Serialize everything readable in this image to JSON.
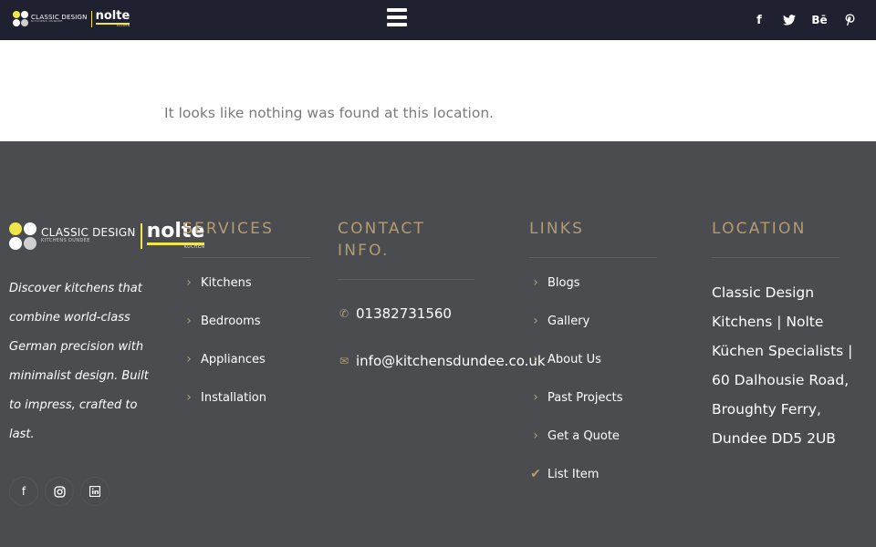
{
  "header": {
    "logo": {
      "brand_left": "CLASSIC DESIGN",
      "brand_left_sub": "KITCHENS DUNDEE",
      "brand_right": "nolte",
      "brand_right_sub": "KÜCHEN"
    },
    "menu_icon": "hamburger-menu-icon",
    "social": [
      {
        "icon": "facebook-icon",
        "glyph": "f"
      },
      {
        "icon": "twitter-icon",
        "glyph": "🐦"
      },
      {
        "icon": "behance-icon",
        "glyph": "Bē"
      },
      {
        "icon": "pinterest-icon",
        "glyph": "P"
      }
    ]
  },
  "main": {
    "message": "It looks like nothing was found at this location."
  },
  "footer": {
    "logo": {
      "brand_left": "CLASSIC DESIGN",
      "brand_left_sub": "KITCHENS DUNDEE",
      "brand_right": "nolte",
      "brand_right_sub": "KÜCHEN"
    },
    "tagline": "Discover kitchens that combine world-class German precision with minimalist design. Built to impress, crafted to last.",
    "social": [
      {
        "icon": "facebook-icon",
        "glyph": "f"
      },
      {
        "icon": "instagram-icon",
        "glyph": "◎"
      },
      {
        "icon": "linkedin-icon",
        "glyph": "in"
      }
    ],
    "services": {
      "title": "SERVICES",
      "items": [
        "Kitchens",
        "Bedrooms",
        "Appliances",
        "Installation"
      ]
    },
    "contact": {
      "title_line1": "CONTACT",
      "title_line2": "INFO.",
      "phone": "01382731560",
      "email": "info@kitchensdundee.co.uk"
    },
    "links": {
      "title": "LINKS",
      "items": [
        "Blogs",
        "Gallery",
        "About Us",
        "Past Projects",
        "Get a Quote",
        "List Item"
      ]
    },
    "location": {
      "title": "LOCATION",
      "address": "Classic Design Kitchens | Nolte Küchen Specialists | 60 Dalhousie Road, Broughty Ferry, Dundee DD5 2UB"
    }
  },
  "colors": {
    "header_bg": "#202130",
    "footer_bg": "#4a4c50",
    "accent_gold": "#b39b73",
    "logo_yellow": "#f0e64a",
    "message_text": "#7a7a7a"
  }
}
